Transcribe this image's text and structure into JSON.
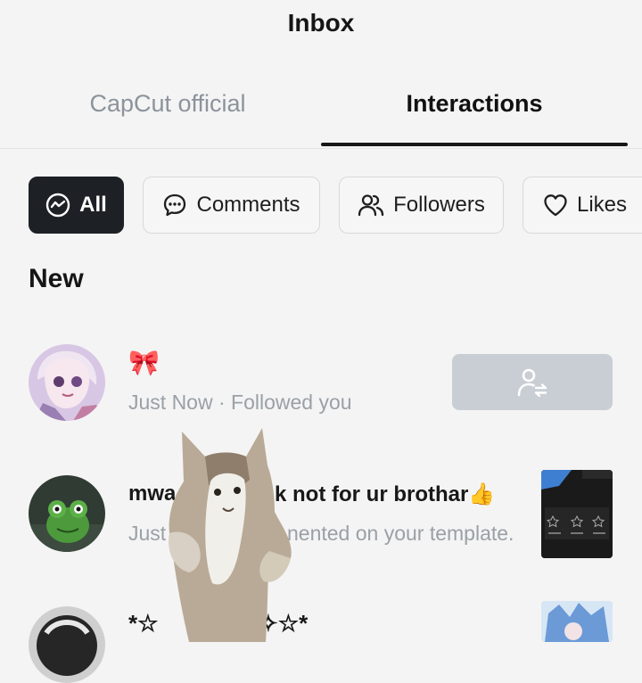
{
  "header": {
    "title": "Inbox"
  },
  "tabs": [
    {
      "label": "CapCut official",
      "active": false
    },
    {
      "label": "Interactions",
      "active": true
    }
  ],
  "filters": [
    {
      "label": "All",
      "icon": "all-icon",
      "active": true
    },
    {
      "label": "Comments",
      "icon": "comment-icon",
      "active": false
    },
    {
      "label": "Followers",
      "icon": "followers-icon",
      "active": false
    },
    {
      "label": "Likes",
      "icon": "heart-icon",
      "active": false
    }
  ],
  "section": {
    "title": "New"
  },
  "notifications": [
    {
      "name": "🎀",
      "meta": "Just Now · Followed you",
      "action": "follow-back",
      "action_icon": "person-swap-icon"
    },
    {
      "name": "mwa",
      "name_tail": "k not for ur brothar👍",
      "meta": "Just",
      "meta_tail": "nented on your template.",
      "thumbnail": "template-thumbnail"
    },
    {
      "name": "*☆",
      "name_tail": "✧☆*",
      "thumbnail": "anime-thumbnail"
    }
  ],
  "colors": {
    "background": "#f4f4f4",
    "active_chip": "#1d2025",
    "muted_text": "#9aa0a6",
    "follow_button": "#c9ced4"
  },
  "overlay": {
    "sticker": "dancing-cat-sticker"
  }
}
